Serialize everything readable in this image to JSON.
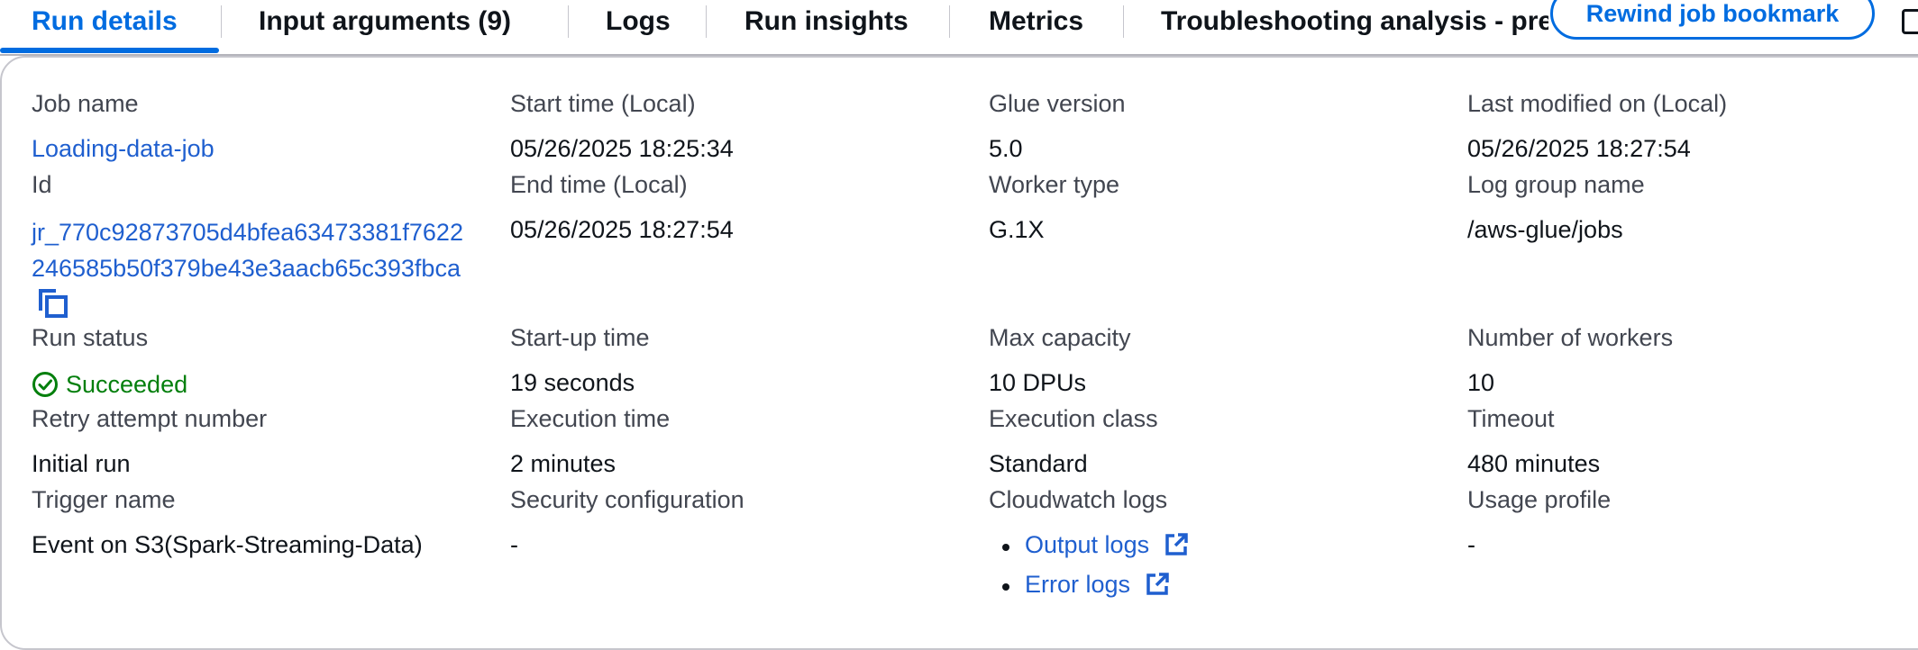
{
  "tabs": {
    "run_details": "Run details",
    "input_arguments": "Input arguments (9)",
    "logs": "Logs",
    "run_insights": "Run insights",
    "metrics": "Metrics",
    "troubleshooting": "Troubleshooting analysis - preview",
    "rewind_button": "Rewind job bookmark"
  },
  "details": {
    "job_name": {
      "label": "Job name",
      "value": "Loading-data-job"
    },
    "start_time": {
      "label": "Start time (Local)",
      "value": "05/26/2025 18:25:34"
    },
    "glue_version": {
      "label": "Glue version",
      "value": "5.0"
    },
    "last_modified": {
      "label": "Last modified on (Local)",
      "value": "05/26/2025 18:27:54"
    },
    "id": {
      "label": "Id",
      "value_line1": "jr_770c92873705d4bfea63473381f7622",
      "value_line2": "246585b50f379be43e3aacb65c393fbca"
    },
    "end_time": {
      "label": "End time (Local)",
      "value": "05/26/2025 18:27:54"
    },
    "worker_type": {
      "label": "Worker type",
      "value": "G.1X"
    },
    "log_group": {
      "label": "Log group name",
      "value": "/aws-glue/jobs"
    },
    "run_status": {
      "label": "Run status",
      "value": "Succeeded"
    },
    "startup_time": {
      "label": "Start-up time",
      "value": "19 seconds"
    },
    "max_capacity": {
      "label": "Max capacity",
      "value": "10 DPUs"
    },
    "num_workers": {
      "label": "Number of workers",
      "value": "10"
    },
    "retry_attempt": {
      "label": "Retry attempt number",
      "value": "Initial run"
    },
    "execution_time": {
      "label": "Execution time",
      "value": "2 minutes"
    },
    "execution_class": {
      "label": "Execution class",
      "value": "Standard"
    },
    "timeout": {
      "label": "Timeout",
      "value": "480 minutes"
    },
    "trigger_name": {
      "label": "Trigger name",
      "value": "Event on S3(Spark-Streaming-Data)"
    },
    "security_config": {
      "label": "Security configuration",
      "value": "-"
    },
    "cloudwatch_logs": {
      "label": "Cloudwatch logs",
      "output_logs": "Output logs",
      "error_logs": "Error logs"
    },
    "usage_profile": {
      "label": "Usage profile",
      "value": "-"
    }
  },
  "icons": {
    "copy": "copy-icon",
    "status": "check-circle-icon",
    "external": "external-link-icon"
  },
  "colors": {
    "accent": "#006ce0",
    "link": "#1f5fcf",
    "success": "#037f0c",
    "label": "#424650"
  }
}
